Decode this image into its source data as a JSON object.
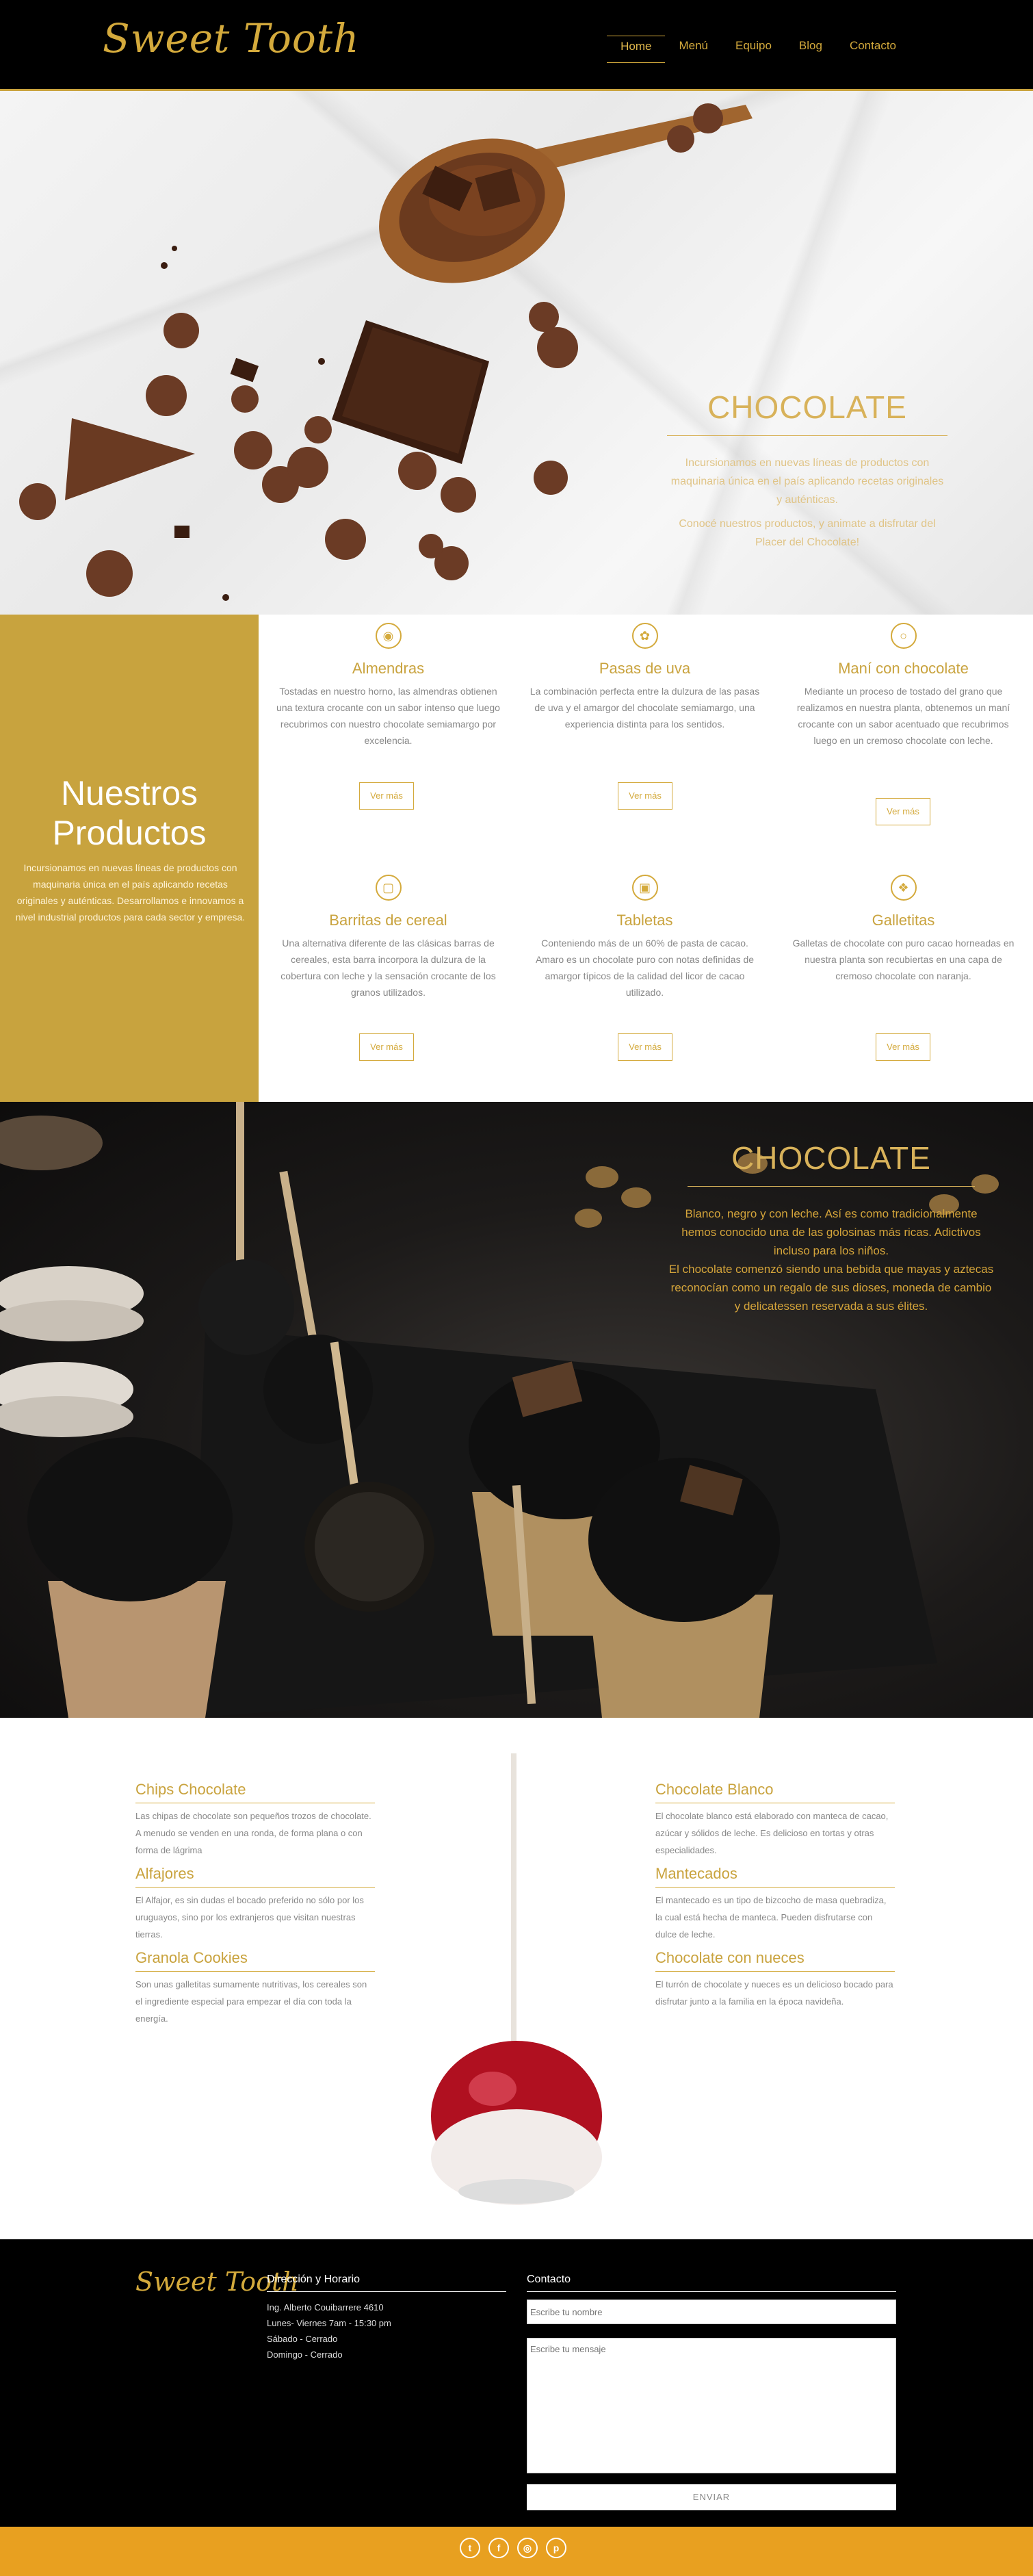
{
  "brand": {
    "logo_text": "Sweet Tooth",
    "accent": "#c9a33e",
    "footer_bar": "#e8a020"
  },
  "nav": {
    "items": [
      "Home",
      "Menú",
      "Equipo",
      "Blog",
      "Contacto"
    ],
    "active": "Home"
  },
  "hero1": {
    "title": "CHOCOLATE",
    "p1": "Incursionamos en nuevas líneas de productos con maquinaria única en el país aplicando recetas originales y auténticas.",
    "p2": "Conocé nuestros productos, y animate a disfrutar del Placer del Chocolate!"
  },
  "products": {
    "title": "Nuestros Productos",
    "description": "Incursionamos en nuevas líneas de productos con maquinaria única en el país aplicando recetas originales y auténticas. Desarrollamos e innovamos a nivel industrial productos para cada sector y empresa.",
    "more_label": "Ver más",
    "items": [
      {
        "name": "Almendras",
        "icon": "almond-icon",
        "text": "Tostadas en nuestro horno, las almendras obtienen una textura crocante con un sabor intenso que luego recubrimos con nuestro chocolate semiamargo por excelencia."
      },
      {
        "name": "Pasas de uva",
        "icon": "grapes-icon",
        "text": "La combinación perfecta entre la dulzura de las pasas de uva y el amargor del chocolate semiamargo, una experiencia distinta para los sentidos."
      },
      {
        "name": "Maní con chocolate",
        "icon": "peanut-icon",
        "text": "Mediante un proceso de tostado del grano que realizamos en nuestra planta, obtenemos un maní crocante con un sabor acentuado que recubrimos luego en un cremoso chocolate con leche."
      },
      {
        "name": "Barritas de cereal",
        "icon": "cereal-bar-icon",
        "text": "Una alternativa diferente de las clásicas barras de cereales, esta barra incorpora la dulzura de la cobertura con leche y la sensación crocante de los granos utilizados."
      },
      {
        "name": "Tabletas",
        "icon": "tablet-icon",
        "text": "Conteniendo más de un 60% de pasta de cacao. Amaro es un chocolate puro con notas definidas de amargor típicos de la calidad del licor de cacao utilizado."
      },
      {
        "name": "Galletitas",
        "icon": "cookie-icon",
        "text": "Galletas de chocolate con puro cacao horneadas en nuestra planta son recubiertas en una capa de cremoso chocolate con naranja."
      }
    ]
  },
  "hero2": {
    "title": "CHOCOLATE",
    "p1": "Blanco, negro y con leche. Así es como tradicionalmente hemos conocido una de las golosinas más ricas. Adictivos incluso para los niños.",
    "p2": "El chocolate comenzó siendo una bebida que mayas y aztecas reconocían como un regalo de sus dioses, moneda de cambio y delicatessen reservada a sus élites."
  },
  "sweets": {
    "left": [
      {
        "title": "Chips Chocolate",
        "text": "Las chipas de chocolate son pequeños trozos de chocolate. A menudo se venden en una ronda, de forma plana o con forma de lágrima"
      },
      {
        "title": "Alfajores",
        "text": "El Alfajor, es sin dudas el bocado preferido no sólo por los uruguayos, sino por los extranjeros que visitan nuestras tierras."
      },
      {
        "title": "Granola Cookies",
        "text": "Son unas galletitas sumamente nutritivas, los cereales son el ingrediente especial para empezar el día con toda la energía."
      }
    ],
    "right": [
      {
        "title": "Chocolate Blanco",
        "text": "El chocolate blanco está elaborado con manteca de cacao, azúcar y sólidos de leche. Es delicioso en tortas y otras especialidades."
      },
      {
        "title": "Mantecados",
        "text": "El mantecado es un tipo de bizcocho de masa quebradiza, la cual está hecha de manteca. Pueden disfrutarse con dulce de leche."
      },
      {
        "title": "Chocolate con nueces",
        "text": "El turrón de chocolate y nueces es un delicioso bocado para disfrutar junto a la familia en la época navideña."
      }
    ]
  },
  "footer": {
    "logo_text": "Sweet Tooth",
    "address_title": "Dirección y Horario",
    "address_lines": [
      "Ing. Alberto Couibarrere 4610",
      "Lunes- Viernes 7am - 15:30 pm",
      "Sábado - Cerrado",
      "Domingo - Cerrado"
    ],
    "contact_title": "Contacto",
    "name_placeholder": "Escribe tu nombre",
    "message_placeholder": "Escribe tu mensaje",
    "send_label": "ENVIAR",
    "social": [
      "twitter-icon",
      "facebook-icon",
      "instagram-icon",
      "pinterest-icon"
    ]
  }
}
